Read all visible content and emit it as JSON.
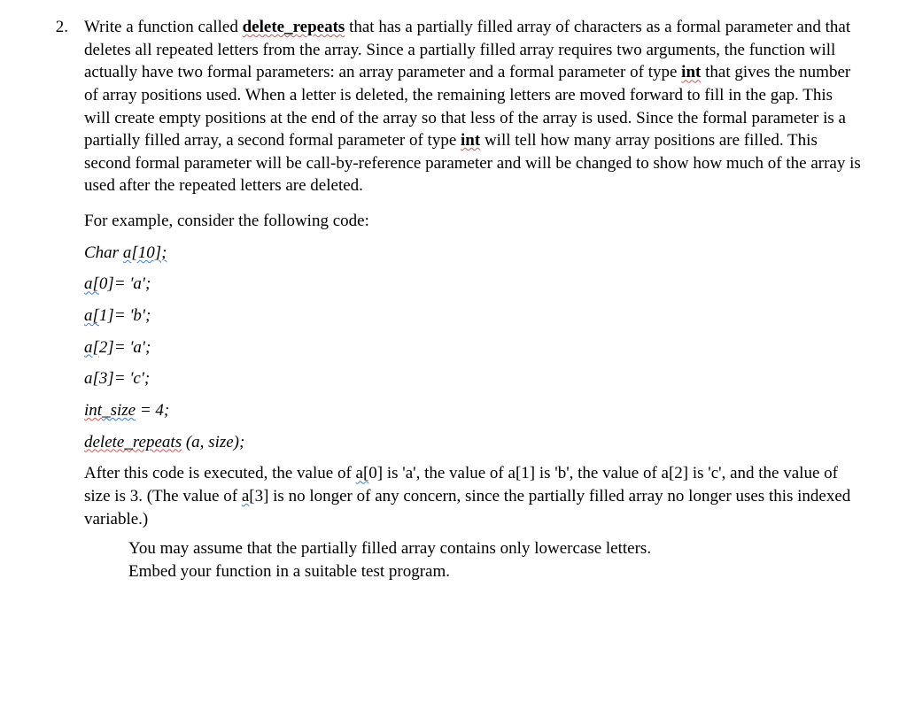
{
  "question": {
    "number": "2.",
    "main_text_parts": {
      "t1": "Write a function called ",
      "t2": "delete_repeats",
      "t3": " that has a partially filled array of characters as a formal parameter and that deletes all repeated letters from the array. Since a partially filled array requires two arguments, the function will actually have two formal parameters: an array parameter and a formal parameter of type ",
      "t4": "int",
      "t5": " that gives the number of array positions used. When a letter is deleted, the remaining letters are moved forward to fill in the gap. This will create empty positions at the end of the array so that less of the array is used. Since the formal parameter is a partially filled array, a second formal parameter of type ",
      "t6": "int",
      "t7": " will tell how many array positions are filled. This second formal parameter will be call-by-reference parameter and will be changed to show how much of the array is used after the repeated letters are deleted."
    },
    "example_intro": "For example, consider the following code:",
    "code": {
      "decl_char": "Char ",
      "decl_a10": "a[10];",
      "l0_a": "a[",
      "l0_b": "0]= 'a';",
      "l1_a": "a[",
      "l1_b": "1]= 'b';",
      "l2_a": "a[",
      "l2_b": "2]= 'a';",
      "l3": "a[3]= 'c';",
      "sz_a": "int",
      "sz_b": "_size",
      "sz_c": " = 4;",
      "call_a": "delete_repeats",
      "call_b": " (a, size);"
    },
    "after": {
      "p1": "After this code is executed, the value of ",
      "p2": "a[",
      "p3": "0] is 'a', the value of a[1] is 'b', the value of a[2] is 'c', and the value of size is 3. (The value of ",
      "p4": "a[",
      "p5": "3] is no longer of any concern, since the partially filled array no longer uses this indexed variable.)"
    },
    "note_line1": "You may assume that the partially filled array contains only lowercase letters.",
    "note_line2": "Embed your function in a suitable test program."
  }
}
